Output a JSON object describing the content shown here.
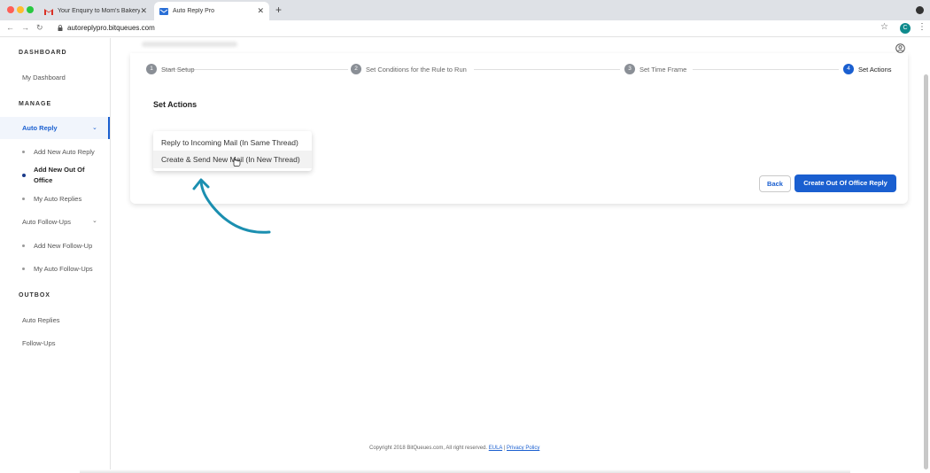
{
  "browser": {
    "tabs": [
      {
        "title": "Your Enquiry to Mom's Bakery",
        "icon": "gmail-icon",
        "close": "✕"
      },
      {
        "title": "Auto Reply Pro",
        "icon": "autoreply-icon",
        "close": "✕"
      }
    ],
    "new_tab": "+",
    "url": "autoreplypro.bitqueues.com",
    "profile_initial": "C"
  },
  "sidebar": {
    "dashboard_heading": "DASHBOARD",
    "my_dashboard": "My Dashboard",
    "manage_heading": "MANAGE",
    "auto_reply": "Auto Reply",
    "auto_reply_items": [
      "Add New Auto Reply",
      "Add New Out Of Office",
      "My Auto Replies"
    ],
    "auto_followups": "Auto Follow-Ups",
    "followup_items": [
      "Add New Follow-Up",
      "My Auto Follow-Ups"
    ],
    "outbox_heading": "OUTBOX",
    "outbox_items": [
      "Auto Replies",
      "Follow-Ups"
    ]
  },
  "steps": [
    {
      "num": "1",
      "label": "Start Setup"
    },
    {
      "num": "2",
      "label": "Set Conditions for the Rule to Run"
    },
    {
      "num": "3",
      "label": "Set Time Frame"
    },
    {
      "num": "4",
      "label": "Set Actions"
    }
  ],
  "section_title": "Set Actions",
  "dropdown_options": [
    "Reply to Incoming Mail (In Same Thread)",
    "Create & Send New Mail (In New Thread)"
  ],
  "buttons": {
    "back": "Back",
    "create": "Create Out Of Office Reply"
  },
  "footer": {
    "copyright": "Copyright 2018 BitQueues.com, All right reserved.",
    "eula": "EULA",
    "sep": "|",
    "privacy": "Privacy Policy"
  },
  "colors": {
    "accent": "#1a5fd0",
    "annotation_arrow": "#1b8fb0"
  }
}
